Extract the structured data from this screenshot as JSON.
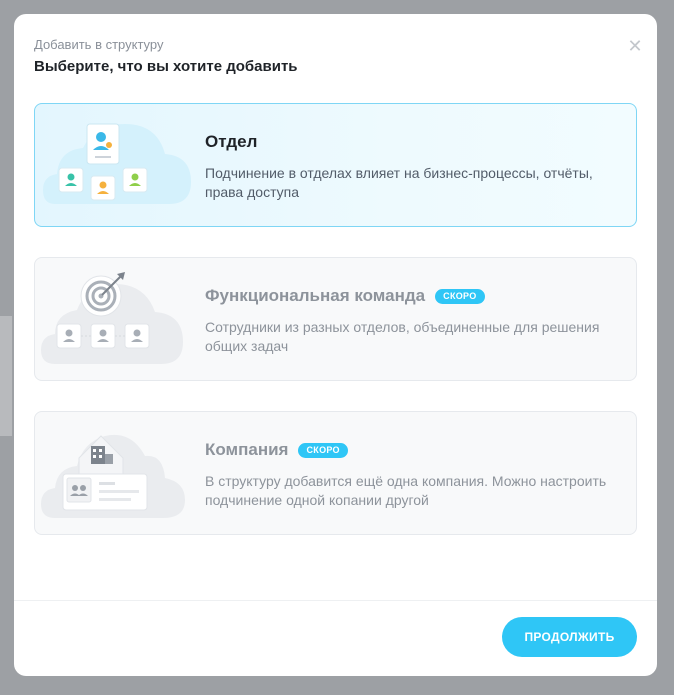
{
  "header": {
    "subtitle": "Добавить в структуру",
    "title": "Выберите, что вы хотите добавить"
  },
  "close_icon": "close-icon",
  "options": [
    {
      "title": "Отдел",
      "description": "Подчинение в отделах влияет на бизнес-процессы, отчёты, права доступа",
      "badge": "",
      "selected": true,
      "icon": "department-illustration"
    },
    {
      "title": "Функциональная команда",
      "description": "Сотрудники из разных отделов, объединенные для решения общих задач",
      "badge": "СКОРО",
      "selected": false,
      "icon": "team-target-illustration"
    },
    {
      "title": "Компания",
      "description": "В структуру добавится ещё одна компания. Можно настроить подчинение одной копании другой",
      "badge": "СКОРО",
      "selected": false,
      "icon": "company-building-illustration"
    }
  ],
  "footer": {
    "continue_label": "ПРОДОЛЖИТЬ"
  },
  "colors": {
    "accent": "#2fc6f6",
    "selected_border": "#7fd6f5",
    "overlay": "#9da0a4"
  }
}
